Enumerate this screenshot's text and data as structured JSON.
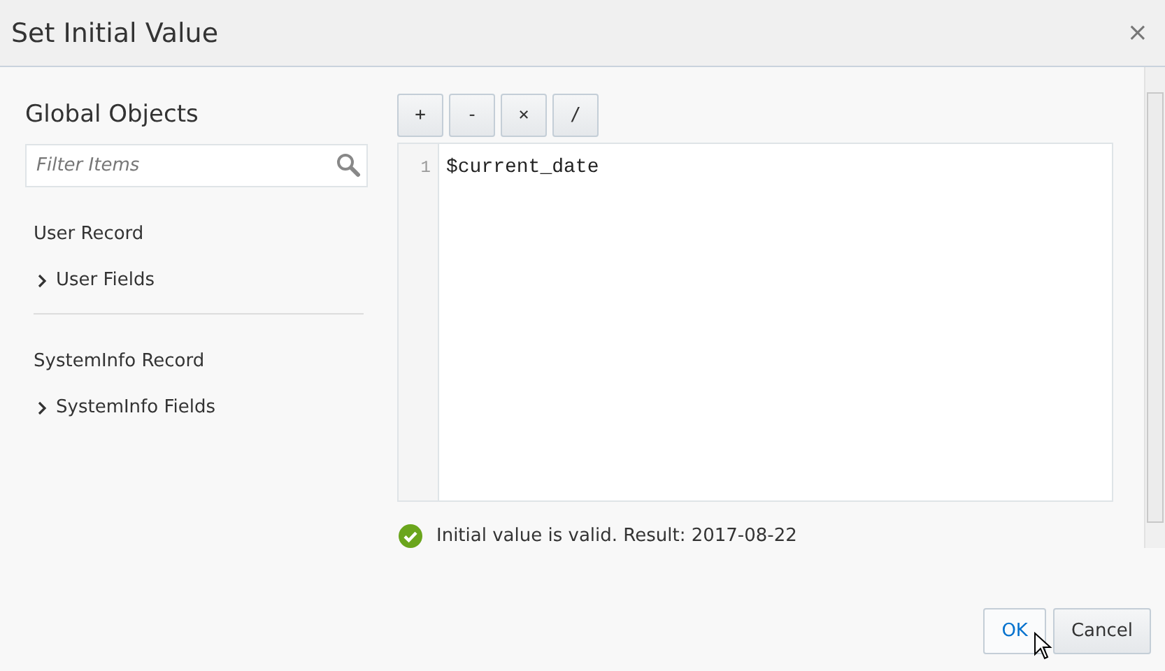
{
  "window": {
    "title": "Set Initial Value",
    "close": "×"
  },
  "sidebar": {
    "title": "Global Objects",
    "search": {
      "placeholder": "Filter Items"
    },
    "groups": [
      {
        "label": "User Record",
        "items": [
          {
            "label": "User Fields",
            "expanded": false
          }
        ]
      },
      {
        "label": "SystemInfo Record",
        "items": [
          {
            "label": "SystemInfo Fields",
            "expanded": false
          }
        ]
      }
    ]
  },
  "operators": [
    "+",
    "-",
    "×",
    "/"
  ],
  "editor": {
    "lines": [
      {
        "number": "1",
        "text": "$current_date"
      }
    ]
  },
  "validation": {
    "valid": true,
    "message": "Initial value is valid. Result: 2017-08-22"
  },
  "buttons": [
    {
      "label": "OK",
      "kind": "primary"
    },
    {
      "label": "Cancel",
      "kind": "secondary"
    }
  ]
}
